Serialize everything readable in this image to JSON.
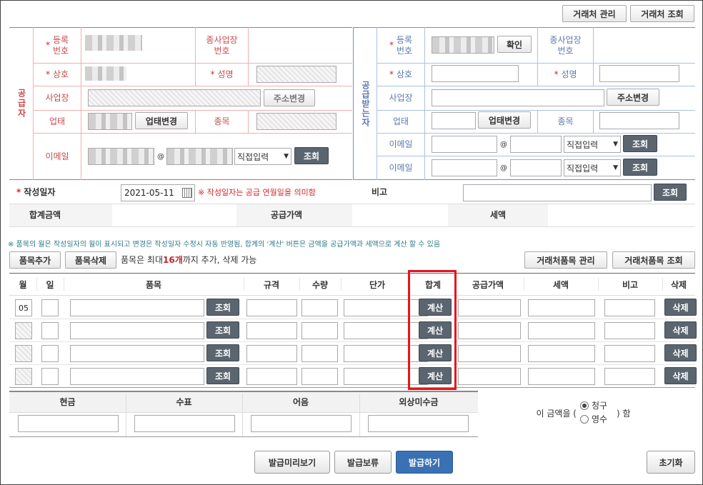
{
  "top_buttons": {
    "partner_manage": "거래처 관리",
    "partner_lookup": "거래처 조회"
  },
  "supplier": {
    "side_label": "공급자",
    "reg_no_label": "등록\n번호",
    "sub_biz_label": "종사업장\n번호",
    "name_label": "상호",
    "ceo_label": "성명",
    "address_label": "사업장",
    "address_change": "주소변경",
    "biz_type_label": "업태",
    "biz_type_change": "업태변경",
    "biz_item_label": "종목",
    "email_label": "이메일",
    "email_at": "@",
    "email_domain_select": "직접입력",
    "lookup": "조회"
  },
  "receiver": {
    "side_label": "공급받는자",
    "reg_no_label": "등록\n번호",
    "confirm": "확인",
    "sub_biz_label": "종사업장\n번호",
    "name_label": "상호",
    "ceo_label": "성명",
    "address_label": "사업장",
    "address_change": "주소변경",
    "biz_type_label": "업태",
    "biz_type_change": "업태변경",
    "biz_item_label": "종목",
    "email_label": "이메일",
    "email_at": "@",
    "email_domain_select": "직접입력",
    "lookup": "조회"
  },
  "write_date": {
    "label": "작성일자",
    "value": "2021-05-11",
    "note": "※ 작성일자는 공급 연월일을 의미함",
    "remark_label": "비고",
    "lookup": "조회"
  },
  "totals": {
    "total_label": "합계금액",
    "supply_label": "공급가액",
    "tax_label": "세액"
  },
  "notice": "※ 품목의 월은 작성일자의 월이 표시되고 변경은 작성일자 수정시 자동 반영됨, 합계의 '계산' 버튼은 금액을 공급가액과 세액으로 계산 할 수 있음",
  "item_toolbar": {
    "add": "품목추가",
    "delete": "품목삭제",
    "limit_pre": "품목은 최대 ",
    "limit_num": "16개",
    "limit_post": "까지 추가, 삭제 가능",
    "item_manage": "거래처품목 관리",
    "item_lookup": "거래처품목 조회"
  },
  "item_table": {
    "headers": [
      "월",
      "일",
      "품목",
      "규격",
      "수량",
      "단가",
      "합계",
      "공급가액",
      "세액",
      "비고",
      "삭제"
    ],
    "rows": [
      {
        "month": "05",
        "lookup": "조회",
        "calc": "계산",
        "delete": "삭제"
      },
      {
        "month": "",
        "lookup": "조회",
        "calc": "계산",
        "delete": "삭제"
      },
      {
        "month": "",
        "lookup": "조회",
        "calc": "계산",
        "delete": "삭제"
      },
      {
        "month": "",
        "lookup": "조회",
        "calc": "계산",
        "delete": "삭제"
      }
    ]
  },
  "payment": {
    "headers": [
      "현금",
      "수표",
      "어음",
      "외상미수금"
    ],
    "amount_pre": "이 금액을 (",
    "claim": "청구",
    "receipt": "영수",
    "amount_post": ") 함"
  },
  "bottom_buttons": {
    "preview": "발급미리보기",
    "hold": "발급보류",
    "issue": "발급하기",
    "reset": "초기화"
  },
  "colors": {
    "supplier_red": "#e06060",
    "receiver_blue": "#6a90d0",
    "highlight": "#e8141a",
    "primary": "#3a70b4"
  }
}
